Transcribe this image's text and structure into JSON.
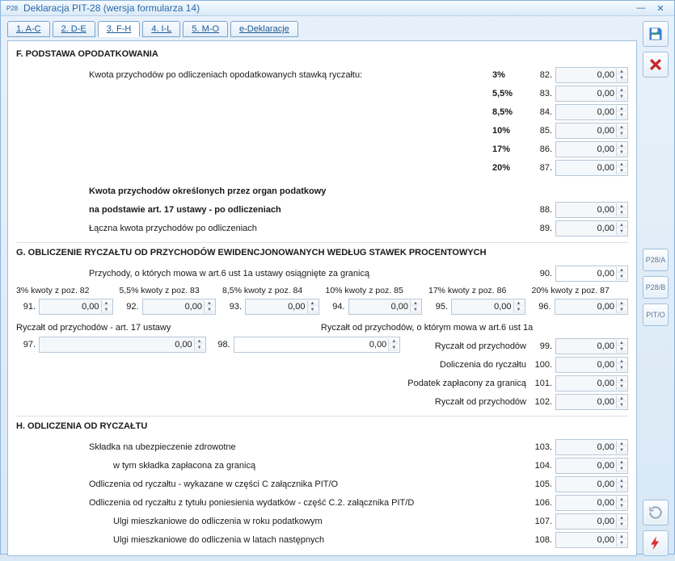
{
  "window": {
    "title": "Deklaracja PIT-28 (wersja formularza 14)",
    "icon": "P28"
  },
  "tabs": [
    {
      "label": "1. A-C"
    },
    {
      "label": "2. D-E"
    },
    {
      "label": "3. F-H"
    },
    {
      "label": "4. I-L"
    },
    {
      "label": "5. M-O"
    },
    {
      "label": "e-Deklaracje"
    }
  ],
  "activeTab": 2,
  "sectionF": {
    "title": "F. PODSTAWA OPODATKOWANIA",
    "line1": "Kwota przychodów po odliczeniach opodatkowanych stawką ryczałtu:",
    "rates": [
      {
        "pct": "3%",
        "num": "82.",
        "val": "0,00"
      },
      {
        "pct": "5,5%",
        "num": "83.",
        "val": "0,00"
      },
      {
        "pct": "8,5%",
        "num": "84.",
        "val": "0,00"
      },
      {
        "pct": "10%",
        "num": "85.",
        "val": "0,00"
      },
      {
        "pct": "17%",
        "num": "86.",
        "val": "0,00"
      },
      {
        "pct": "20%",
        "num": "87.",
        "val": "0,00"
      }
    ],
    "organ1": "Kwota przychodów określonych przez organ podatkowy",
    "organ2": "na podstawie art. 17 ustawy - po odliczeniach",
    "organNum": "88.",
    "organVal": "0,00",
    "total": "Łączna kwota przychodów po odliczeniach",
    "totalNum": "89.",
    "totalVal": "0,00"
  },
  "sectionG": {
    "title": "G. OBLICZENIE RYCZAŁTU OD PRZYCHODÓW EWIDENCJONOWANYCH WEDŁUG STAWEK PROCENTOWYCH",
    "foreign": "Przychody, o których mowa w art.6 ust 1a ustawy osiągnięte za granicą",
    "foreignNum": "90.",
    "foreignVal": "0,00",
    "headers": [
      "3% kwoty z poz. 82",
      "5,5% kwoty z poz. 83",
      "8,5% kwoty z poz. 84",
      "10% kwoty z poz. 85",
      "17% kwoty z poz. 86",
      "20% kwoty z poz. 87"
    ],
    "cells": [
      {
        "num": "91.",
        "val": "0,00"
      },
      {
        "num": "92.",
        "val": "0,00"
      },
      {
        "num": "93.",
        "val": "0,00"
      },
      {
        "num": "94.",
        "val": "0,00"
      },
      {
        "num": "95.",
        "val": "0,00"
      },
      {
        "num": "96.",
        "val": "0,00"
      }
    ],
    "art17": "Ryczałt od przychodów - art. 17 ustawy",
    "art6": "Ryczałt od przychodów, o którym mowa w art.6 ust 1a",
    "f97num": "97.",
    "f97val": "0,00",
    "f98num": "98.",
    "f98val": "0,00",
    "rightRows": [
      {
        "label": "Ryczałt od przychodów",
        "num": "99.",
        "val": "0,00"
      },
      {
        "label": "Doliczenia do ryczałtu",
        "num": "100.",
        "val": "0,00"
      },
      {
        "label": "Podatek zapłacony za granicą",
        "num": "101.",
        "val": "0,00"
      },
      {
        "label": "Ryczałt od przychodów",
        "num": "102.",
        "val": "0,00"
      }
    ]
  },
  "sectionH": {
    "title": "H. ODLICZENIA OD RYCZAŁTU",
    "rows": [
      {
        "label": "Składka na ubezpieczenie zdrowotne",
        "indent": 1,
        "num": "103.",
        "val": "0,00"
      },
      {
        "label": "w tym składka zapłacona za granicą",
        "indent": 2,
        "num": "104.",
        "val": "0,00"
      },
      {
        "label": "Odliczenia od ryczałtu - wykazane w części C załącznika PIT/O",
        "indent": 1,
        "num": "105.",
        "val": "0,00"
      },
      {
        "label": "Odliczenia od ryczałtu z tytułu poniesienia wydatków - część C.2. załącznika PIT/D",
        "indent": 1,
        "num": "106.",
        "val": "0,00"
      },
      {
        "label": "Ulgi mieszkaniowe do odliczenia w roku podatkowym",
        "indent": 2,
        "num": "107.",
        "val": "0,00"
      },
      {
        "label": "Ulgi mieszkaniowe do odliczenia w latach następnych",
        "indent": 2,
        "num": "108.",
        "val": "0,00"
      }
    ]
  },
  "sideButtons": {
    "p28a": "P28/A",
    "p28b": "P28/B",
    "pito": "PIT/O"
  }
}
